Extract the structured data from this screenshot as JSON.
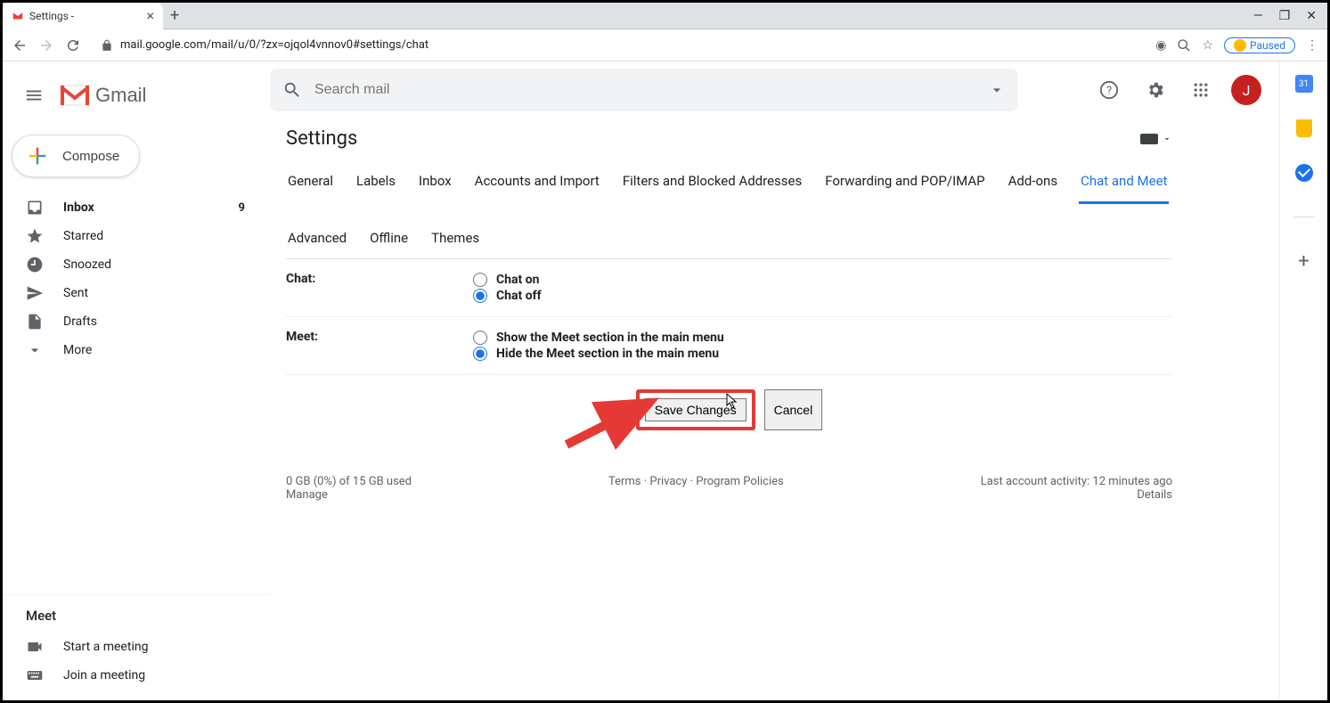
{
  "browser": {
    "tab_title": "Settings -",
    "url": "mail.google.com/mail/u/0/?zx=ojqol4vnnov0#settings/chat",
    "paused_label": "Paused"
  },
  "header": {
    "app_name": "Gmail",
    "search_placeholder": "Search mail"
  },
  "compose_label": "Compose",
  "sidebar": {
    "items": [
      {
        "label": "Inbox",
        "count": "9",
        "bold": true
      },
      {
        "label": "Starred"
      },
      {
        "label": "Snoozed"
      },
      {
        "label": "Sent"
      },
      {
        "label": "Drafts"
      },
      {
        "label": "More"
      }
    ]
  },
  "meet": {
    "header": "Meet",
    "start": "Start a meeting",
    "join": "Join a meeting"
  },
  "settings": {
    "title": "Settings",
    "tabs": [
      "General",
      "Labels",
      "Inbox",
      "Accounts and Import",
      "Filters and Blocked Addresses",
      "Forwarding and POP/IMAP",
      "Add-ons",
      "Chat and Meet",
      "Advanced",
      "Offline",
      "Themes"
    ],
    "active_tab": "Chat and Meet",
    "chat_label": "Chat:",
    "chat_on": "Chat on",
    "chat_off": "Chat off",
    "meet_label": "Meet:",
    "meet_show": "Show the Meet section in the main menu",
    "meet_hide": "Hide the Meet section in the main menu",
    "save_button": "Save Changes",
    "cancel_button": "Cancel"
  },
  "footer": {
    "storage": "0 GB (0%) of 15 GB used",
    "manage": "Manage",
    "terms": "Terms",
    "privacy": "Privacy",
    "policies": "Program Policies",
    "activity": "Last account activity: 12 minutes ago",
    "details": "Details"
  },
  "avatar_letter": "J",
  "calendar_day": "31"
}
